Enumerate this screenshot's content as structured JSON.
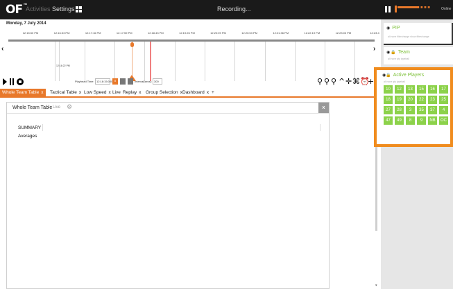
{
  "app": {
    "logo": "OF",
    "logo_mark": "™",
    "nav": {
      "activities": "Activities",
      "settings": "Settings"
    },
    "status": "Recording...",
    "level_percent": 62,
    "connection": "Online"
  },
  "timeline": {
    "date": "Monday, 7 July 2014",
    "ticks": [
      "12:15:50 PM",
      "12:16:33 PM",
      "12:17:16 PM",
      "12:17:59 PM",
      "12:18:43 PM",
      "12:19:26 PM",
      "12:20:09 PM",
      "12:20:53 PM",
      "12:21:36 PM",
      "12:22:19 PM",
      "12:23:03 PM",
      "12:23:4"
    ],
    "inner_label": "12:16:22 PM",
    "nav_left": "‹",
    "nav_right": "›"
  },
  "controls": {
    "playhead_label": "Playhead Time:",
    "playhead_value": "12:18:15:000",
    "orange_btn": "x",
    "interval_label": "Interval(secs):",
    "interval_value": "300"
  },
  "tabs": [
    {
      "label": "Whole Team Table",
      "close": "x"
    },
    {
      "label": "Tactical Table",
      "close": "x"
    },
    {
      "label": "Low Speed",
      "close": "x"
    },
    {
      "label": "Live",
      "close": ""
    },
    {
      "label": "Replay",
      "close": "x"
    },
    {
      "label": "Group Selection",
      "close": "x"
    },
    {
      "label": "Dashboard",
      "close": "x"
    },
    {
      "label": "+",
      "close": ""
    }
  ],
  "panel": {
    "title": "Whole Team Table",
    "live": "Live",
    "close": "x",
    "summary": "SUMMARY",
    "averages": "Averages"
  },
  "sidebar": {
    "pip": {
      "name": "PIP",
      "sub": "all   none   filterchange   show filterchange"
    },
    "team": {
      "name": "Team",
      "sub": "all   none   qty   typeball"
    },
    "players": {
      "name": "Active Players",
      "sub": "all   none   qty   typeball",
      "items": [
        "10",
        "12",
        "13",
        "15",
        "16",
        "17",
        "18",
        "19",
        "20",
        "22",
        "23",
        "25",
        "27",
        "28",
        "3",
        "35",
        "37",
        "4",
        "47",
        "49",
        "8",
        "9",
        "NB",
        "OC"
      ]
    }
  },
  "colors": {
    "accent": "#e8782a",
    "player_green": "#8cd24a",
    "highlight": "#f08c1e",
    "topbar": "#1a1a1a"
  },
  "icons": [
    "play-icon",
    "pause-icon",
    "stop-icon",
    "search-icon",
    "zoom-in-icon",
    "zoom-out-icon",
    "up-icon",
    "expand-icon",
    "collapse-icon",
    "alarm-icon",
    "plus-icon",
    "gear-icon",
    "eye-icon",
    "lock-icon",
    "grid-icon"
  ]
}
